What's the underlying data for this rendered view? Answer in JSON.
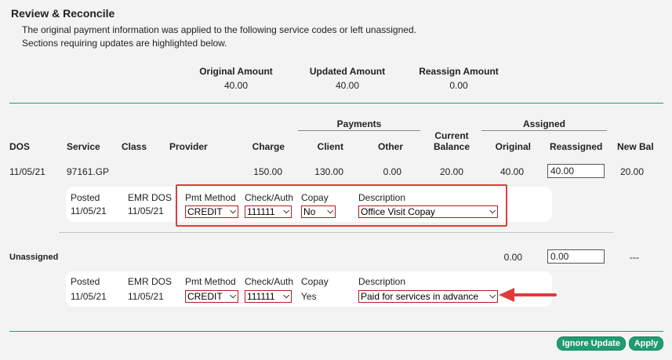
{
  "title": "Review & Reconcile",
  "intro": [
    "The original payment information was applied to the following service codes or left unassigned.",
    "Sections requiring updates are highlighted below."
  ],
  "amounts": {
    "original_label": "Original Amount",
    "original_value": "40.00",
    "updated_label": "Updated Amount",
    "updated_value": "40.00",
    "reassign_label": "Reassign Amount",
    "reassign_value": "0.00"
  },
  "columns": {
    "payments_group": "Payments",
    "assigned_group": "Assigned",
    "dos": "DOS",
    "service": "Service",
    "class": "Class",
    "provider": "Provider",
    "charge": "Charge",
    "client": "Client",
    "other": "Other",
    "current_balance_1": "Current",
    "current_balance_2": "Balance",
    "original": "Original",
    "reassigned": "Reassigned",
    "new_bal": "New Bal"
  },
  "service_row": {
    "dos": "11/05/21",
    "service": "97161.GP",
    "class": "",
    "provider": "",
    "charge": "150.00",
    "client": "130.00",
    "other": "0.00",
    "current_balance": "20.00",
    "original": "40.00",
    "reassigned": "40.00",
    "new_bal": "20.00"
  },
  "detail_labels": {
    "posted": "Posted",
    "emr_dos": "EMR DOS",
    "pmt_method": "Pmt Method",
    "check_auth": "Check/Auth",
    "copay": "Copay",
    "description": "Description"
  },
  "service_detail": {
    "posted": "11/05/21",
    "emr_dos": "11/05/21",
    "pmt_method": "CREDIT",
    "check_auth": "111111",
    "copay": "No",
    "description": "Office Visit Copay"
  },
  "unassigned_row": {
    "label": "Unassigned",
    "original": "0.00",
    "reassigned": "0.00",
    "new_bal": "---"
  },
  "unassigned_detail": {
    "posted": "11/05/21",
    "emr_dos": "11/05/21",
    "pmt_method": "CREDIT",
    "check_auth": "111111",
    "copay": "Yes",
    "description": "Paid for services in advance"
  },
  "buttons": {
    "ignore": "Ignore Update",
    "apply": "Apply"
  },
  "colors": {
    "accent": "#1f9c73",
    "highlight": "#e03b3b"
  },
  "icons": {
    "dropdown": "chevron-down-icon",
    "arrow": "arrow-left-icon"
  }
}
